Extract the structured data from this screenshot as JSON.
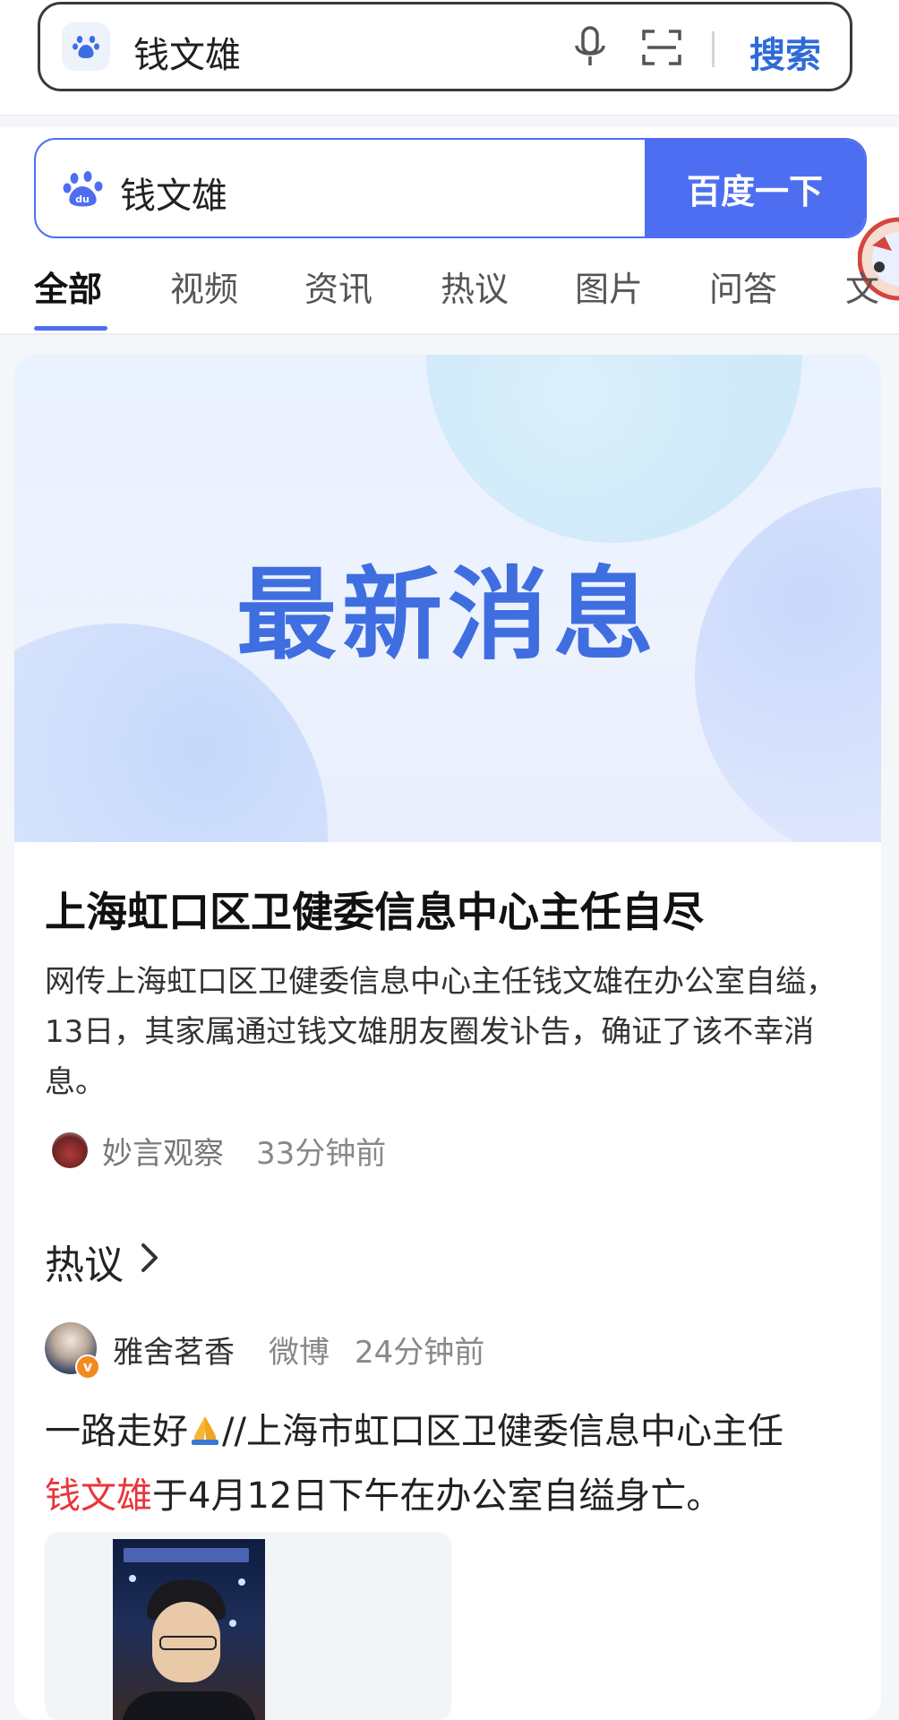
{
  "browser_bar": {
    "query": "钱文雄",
    "search_label": "搜索",
    "icons": [
      "baidu-paw-icon",
      "microphone-icon",
      "scan-icon"
    ]
  },
  "baidu": {
    "query": "钱文雄",
    "button_label": "百度一下",
    "tabs": [
      {
        "label": "全部",
        "active": true
      },
      {
        "label": "视频",
        "active": false
      },
      {
        "label": "资讯",
        "active": false
      },
      {
        "label": "热议",
        "active": false
      },
      {
        "label": "图片",
        "active": false
      },
      {
        "label": "问答",
        "active": false
      },
      {
        "label": "文",
        "active": false
      }
    ],
    "accent_color": "#4e6ef2"
  },
  "news_card": {
    "banner_text": "最新消息",
    "title": "上海虹口区卫健委信息中心主任自尽",
    "summary": "网传上海虹口区卫健委信息中心主任钱文雄在办公室自缢，13日，其家属通过钱文雄朋友圈发讣告，确证了该不幸消息。",
    "source": "妙言观察",
    "time": "33分钟前"
  },
  "hot_discussion": {
    "heading": "热议",
    "post": {
      "user": "雅舍茗香",
      "platform": "微博",
      "time": "24分钟前",
      "text_before": "一路走好",
      "text_after_emoji": "//上海市虹口区卫健委信息中心主任",
      "highlight": "钱文雄",
      "text_end": "于4月12日下午在办公室自缢身亡。",
      "highlight_color": "#e8363c"
    }
  }
}
